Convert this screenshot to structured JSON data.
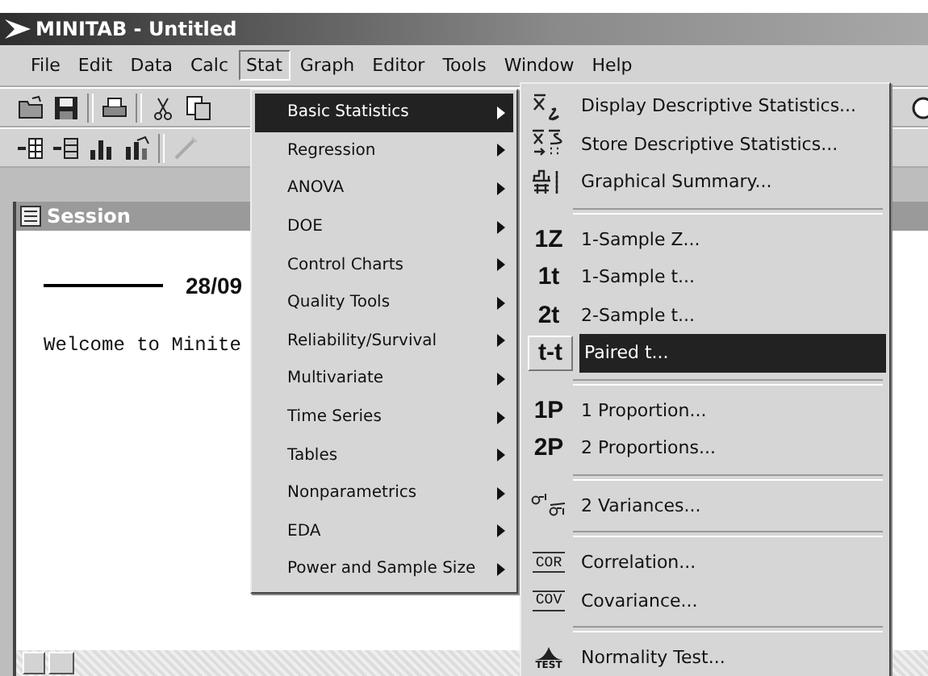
{
  "window": {
    "title": "MINITAB - Untitled"
  },
  "menu_bar": [
    {
      "label": "File",
      "selected": false
    },
    {
      "label": "Edit",
      "selected": false
    },
    {
      "label": "Data",
      "selected": false
    },
    {
      "label": "Calc",
      "selected": false
    },
    {
      "label": "Stat",
      "selected": true
    },
    {
      "label": "Graph",
      "selected": false
    },
    {
      "label": "Editor",
      "selected": false
    },
    {
      "label": "Tools",
      "selected": false
    },
    {
      "label": "Window",
      "selected": false
    },
    {
      "label": "Help",
      "selected": false
    }
  ],
  "session": {
    "title": "Session",
    "date": "28/09",
    "welcome": "Welcome to Minite"
  },
  "stat_menu": [
    {
      "label": "Basic Statistics",
      "selected": true
    },
    {
      "label": "Regression",
      "selected": false
    },
    {
      "label": "ANOVA",
      "selected": false
    },
    {
      "label": "DOE",
      "selected": false
    },
    {
      "label": "Control Charts",
      "selected": false
    },
    {
      "label": "Quality Tools",
      "selected": false
    },
    {
      "label": "Reliability/Survival",
      "selected": false
    },
    {
      "label": "Multivariate",
      "selected": false
    },
    {
      "label": "Time Series",
      "selected": false
    },
    {
      "label": "Tables",
      "selected": false
    },
    {
      "label": "Nonparametrics",
      "selected": false
    },
    {
      "label": "EDA",
      "selected": false
    },
    {
      "label": "Power and Sample Size",
      "selected": false
    }
  ],
  "basic_statistics_submenu": [
    [
      {
        "kind": "xbar",
        "label": "Display Descriptive Statistics...",
        "selected": false
      },
      {
        "kind": "store",
        "label": "Store Descriptive Statistics...",
        "selected": false
      },
      {
        "kind": "summary",
        "label": "Graphical Summary...",
        "selected": false
      }
    ],
    [
      {
        "kind": "text",
        "icon_text": "1Z",
        "label": "1-Sample Z...",
        "selected": false
      },
      {
        "kind": "text",
        "icon_text": "1t",
        "label": "1-Sample t...",
        "selected": false
      },
      {
        "kind": "text",
        "icon_text": "2t",
        "label": "2-Sample t...",
        "selected": false
      },
      {
        "kind": "text",
        "icon_text": "t-t",
        "label": "Paired t...",
        "selected": true
      }
    ],
    [
      {
        "kind": "text",
        "icon_text": "1P",
        "label": "1 Proportion...",
        "selected": false
      },
      {
        "kind": "text",
        "icon_text": "2P",
        "label": "2 Proportions...",
        "selected": false
      }
    ],
    [
      {
        "kind": "variance",
        "label": "2 Variances...",
        "selected": false
      }
    ],
    [
      {
        "kind": "boxed",
        "icon_text": "COR",
        "label": "Correlation...",
        "selected": false
      },
      {
        "kind": "boxed",
        "icon_text": "COV",
        "label": "Covariance...",
        "selected": false
      }
    ],
    [
      {
        "kind": "normal",
        "icon_text": "TEST",
        "label": "Normality Test...",
        "selected": false
      }
    ]
  ]
}
